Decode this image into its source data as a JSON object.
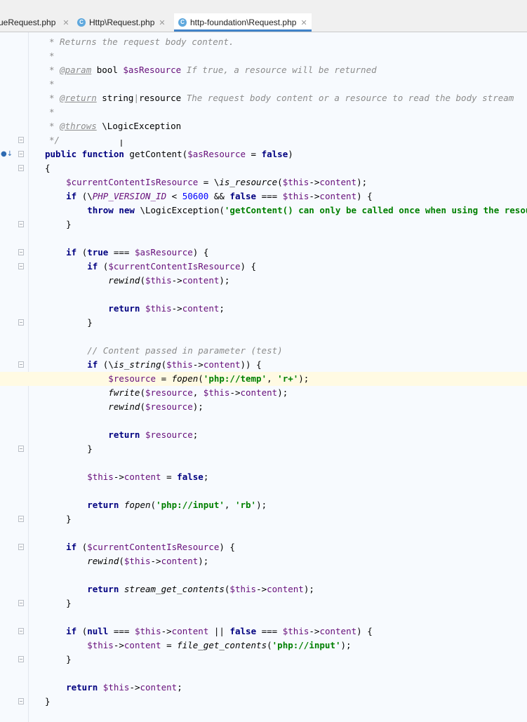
{
  "tabs": [
    {
      "label": "ueRequest.php",
      "close": "✕",
      "icon": null,
      "active": false
    },
    {
      "label": "Http\\Request.php",
      "close": "✕",
      "icon": "C",
      "active": false
    },
    {
      "label": "http-foundation\\Request.php",
      "close": "✕",
      "icon": "C",
      "active": true
    }
  ],
  "accent_color": "#4083c9",
  "code_lines": [
    [
      {
        "t": "c",
        "x": "* Returns the request body content."
      }
    ],
    [
      {
        "t": "c",
        "x": "*"
      }
    ],
    [
      {
        "t": "c",
        "x": "* "
      },
      {
        "t": "c tag",
        "x": "@param"
      },
      {
        "t": "p",
        "x": " bool "
      },
      {
        "t": "v",
        "x": "$asResource"
      },
      {
        "t": "c",
        "x": " If true, a resource will be returned"
      }
    ],
    [
      {
        "t": "c",
        "x": "*"
      }
    ],
    [
      {
        "t": "c",
        "x": "* "
      },
      {
        "t": "c tag",
        "x": "@return"
      },
      {
        "t": "p",
        "x": " string"
      },
      {
        "t": "c",
        "x": "|"
      },
      {
        "t": "p",
        "x": "resource"
      },
      {
        "t": "c",
        "x": " The request body content or a resource to read the body stream"
      }
    ],
    [
      {
        "t": "c",
        "x": "*"
      }
    ],
    [
      {
        "t": "c",
        "x": "* "
      },
      {
        "t": "c tag",
        "x": "@throws"
      },
      {
        "t": "p",
        "x": " \\LogicException"
      }
    ],
    [
      {
        "t": "c",
        "x": "*/"
      }
    ],
    [
      {
        "t": "k",
        "x": "public function "
      },
      {
        "t": "p",
        "x": "getContent("
      },
      {
        "t": "v",
        "x": "$asResource"
      },
      {
        "t": "p",
        "x": " = "
      },
      {
        "t": "k",
        "x": "false"
      },
      {
        "t": "p",
        "x": ")"
      }
    ],
    [
      {
        "t": "p",
        "x": "{"
      }
    ],
    [
      {
        "t": "v",
        "x": "    $currentContentIsResource"
      },
      {
        "t": "p",
        "x": " = \\"
      },
      {
        "t": "fn",
        "x": "is_resource"
      },
      {
        "t": "p",
        "x": "("
      },
      {
        "t": "v",
        "x": "$this"
      },
      {
        "t": "p",
        "x": "->"
      },
      {
        "t": "v",
        "x": "content"
      },
      {
        "t": "p",
        "x": ");"
      }
    ],
    [
      {
        "t": "k",
        "x": "    if "
      },
      {
        "t": "p",
        "x": "(\\"
      },
      {
        "t": "cn",
        "x": "PHP_VERSION_ID"
      },
      {
        "t": "p",
        "x": " < "
      },
      {
        "t": "n",
        "x": "50600"
      },
      {
        "t": "p",
        "x": " && "
      },
      {
        "t": "k",
        "x": "false"
      },
      {
        "t": "p",
        "x": " === "
      },
      {
        "t": "v",
        "x": "$this"
      },
      {
        "t": "p",
        "x": "->"
      },
      {
        "t": "v",
        "x": "content"
      },
      {
        "t": "p",
        "x": ") {"
      }
    ],
    [
      {
        "t": "k",
        "x": "        throw new "
      },
      {
        "t": "p",
        "x": "\\LogicException("
      },
      {
        "t": "s",
        "x": "'getContent() can only be called once when using the resource re"
      }
    ],
    [
      {
        "t": "p",
        "x": "    }"
      }
    ],
    [],
    [
      {
        "t": "k",
        "x": "    if "
      },
      {
        "t": "p",
        "x": "("
      },
      {
        "t": "k",
        "x": "true"
      },
      {
        "t": "p",
        "x": " === "
      },
      {
        "t": "v",
        "x": "$asResource"
      },
      {
        "t": "p",
        "x": ") {"
      }
    ],
    [
      {
        "t": "k",
        "x": "        if "
      },
      {
        "t": "p",
        "x": "("
      },
      {
        "t": "v",
        "x": "$currentContentIsResource"
      },
      {
        "t": "p",
        "x": ") {"
      }
    ],
    [
      {
        "t": "fn",
        "x": "            rewind"
      },
      {
        "t": "p",
        "x": "("
      },
      {
        "t": "v",
        "x": "$this"
      },
      {
        "t": "p",
        "x": "->"
      },
      {
        "t": "v",
        "x": "content"
      },
      {
        "t": "p",
        "x": ");"
      }
    ],
    [],
    [
      {
        "t": "k",
        "x": "            return "
      },
      {
        "t": "v",
        "x": "$this"
      },
      {
        "t": "p",
        "x": "->"
      },
      {
        "t": "v",
        "x": "content"
      },
      {
        "t": "p",
        "x": ";"
      }
    ],
    [
      {
        "t": "p",
        "x": "        }"
      }
    ],
    [],
    [
      {
        "t": "c",
        "x": "        // Content passed in parameter (test)"
      }
    ],
    [
      {
        "t": "k",
        "x": "        if "
      },
      {
        "t": "p",
        "x": "(\\"
      },
      {
        "t": "fn",
        "x": "is_string"
      },
      {
        "t": "p",
        "x": "("
      },
      {
        "t": "v",
        "x": "$this"
      },
      {
        "t": "p",
        "x": "->"
      },
      {
        "t": "v",
        "x": "content"
      },
      {
        "t": "p",
        "x": ")) {"
      }
    ],
    [
      {
        "t": "v",
        "x": "            $resource"
      },
      {
        "t": "p",
        "x": " = "
      },
      {
        "t": "fn",
        "x": "fopen"
      },
      {
        "t": "p",
        "x": "("
      },
      {
        "t": "s",
        "x": "'php://temp'"
      },
      {
        "t": "p",
        "x": ", "
      },
      {
        "t": "s",
        "x": "'r+'"
      },
      {
        "t": "p",
        "x": ");"
      }
    ],
    [
      {
        "t": "fn",
        "x": "            fwrite"
      },
      {
        "t": "p",
        "x": "("
      },
      {
        "t": "v",
        "x": "$resource"
      },
      {
        "t": "p",
        "x": ", "
      },
      {
        "t": "v",
        "x": "$this"
      },
      {
        "t": "p",
        "x": "->"
      },
      {
        "t": "v",
        "x": "content"
      },
      {
        "t": "p",
        "x": ");"
      }
    ],
    [
      {
        "t": "fn",
        "x": "            rewind"
      },
      {
        "t": "p",
        "x": "("
      },
      {
        "t": "v",
        "x": "$resource"
      },
      {
        "t": "p",
        "x": ");"
      }
    ],
    [],
    [
      {
        "t": "k",
        "x": "            return "
      },
      {
        "t": "v",
        "x": "$resource"
      },
      {
        "t": "p",
        "x": ";"
      }
    ],
    [
      {
        "t": "p",
        "x": "        }"
      }
    ],
    [],
    [
      {
        "t": "v",
        "x": "        $this"
      },
      {
        "t": "p",
        "x": "->"
      },
      {
        "t": "v",
        "x": "content"
      },
      {
        "t": "p",
        "x": " = "
      },
      {
        "t": "k",
        "x": "false"
      },
      {
        "t": "p",
        "x": ";"
      }
    ],
    [],
    [
      {
        "t": "k",
        "x": "        return "
      },
      {
        "t": "fn",
        "x": "fopen"
      },
      {
        "t": "p",
        "x": "("
      },
      {
        "t": "s",
        "x": "'php://input'"
      },
      {
        "t": "p",
        "x": ", "
      },
      {
        "t": "s",
        "x": "'rb'"
      },
      {
        "t": "p",
        "x": ");"
      }
    ],
    [
      {
        "t": "p",
        "x": "    }"
      }
    ],
    [],
    [
      {
        "t": "k",
        "x": "    if "
      },
      {
        "t": "p",
        "x": "("
      },
      {
        "t": "v",
        "x": "$currentContentIsResource"
      },
      {
        "t": "p",
        "x": ") {"
      }
    ],
    [
      {
        "t": "fn",
        "x": "        rewind"
      },
      {
        "t": "p",
        "x": "("
      },
      {
        "t": "v",
        "x": "$this"
      },
      {
        "t": "p",
        "x": "->"
      },
      {
        "t": "v",
        "x": "content"
      },
      {
        "t": "p",
        "x": ");"
      }
    ],
    [],
    [
      {
        "t": "k",
        "x": "        return "
      },
      {
        "t": "fn",
        "x": "stream_get_contents"
      },
      {
        "t": "p",
        "x": "("
      },
      {
        "t": "v",
        "x": "$this"
      },
      {
        "t": "p",
        "x": "->"
      },
      {
        "t": "v",
        "x": "content"
      },
      {
        "t": "p",
        "x": ");"
      }
    ],
    [
      {
        "t": "p",
        "x": "    }"
      }
    ],
    [],
    [
      {
        "t": "k",
        "x": "    if "
      },
      {
        "t": "p",
        "x": "("
      },
      {
        "t": "k",
        "x": "null"
      },
      {
        "t": "p",
        "x": " === "
      },
      {
        "t": "v",
        "x": "$this"
      },
      {
        "t": "p",
        "x": "->"
      },
      {
        "t": "v",
        "x": "content"
      },
      {
        "t": "p",
        "x": " || "
      },
      {
        "t": "k",
        "x": "false"
      },
      {
        "t": "p",
        "x": " === "
      },
      {
        "t": "v",
        "x": "$this"
      },
      {
        "t": "p",
        "x": "->"
      },
      {
        "t": "v",
        "x": "content"
      },
      {
        "t": "p",
        "x": ") {"
      }
    ],
    [
      {
        "t": "v",
        "x": "        $this"
      },
      {
        "t": "p",
        "x": "->"
      },
      {
        "t": "v",
        "x": "content"
      },
      {
        "t": "p",
        "x": " = "
      },
      {
        "t": "fn",
        "x": "file_get_contents"
      },
      {
        "t": "p",
        "x": "("
      },
      {
        "t": "s",
        "x": "'php://input'"
      },
      {
        "t": "p",
        "x": ");"
      }
    ],
    [
      {
        "t": "p",
        "x": "    }"
      }
    ],
    [],
    [
      {
        "t": "k",
        "x": "    return "
      },
      {
        "t": "v",
        "x": "$this"
      },
      {
        "t": "p",
        "x": "->"
      },
      {
        "t": "v",
        "x": "content"
      },
      {
        "t": "p",
        "x": ";"
      }
    ],
    [
      {
        "t": "p",
        "x": "}"
      }
    ]
  ]
}
